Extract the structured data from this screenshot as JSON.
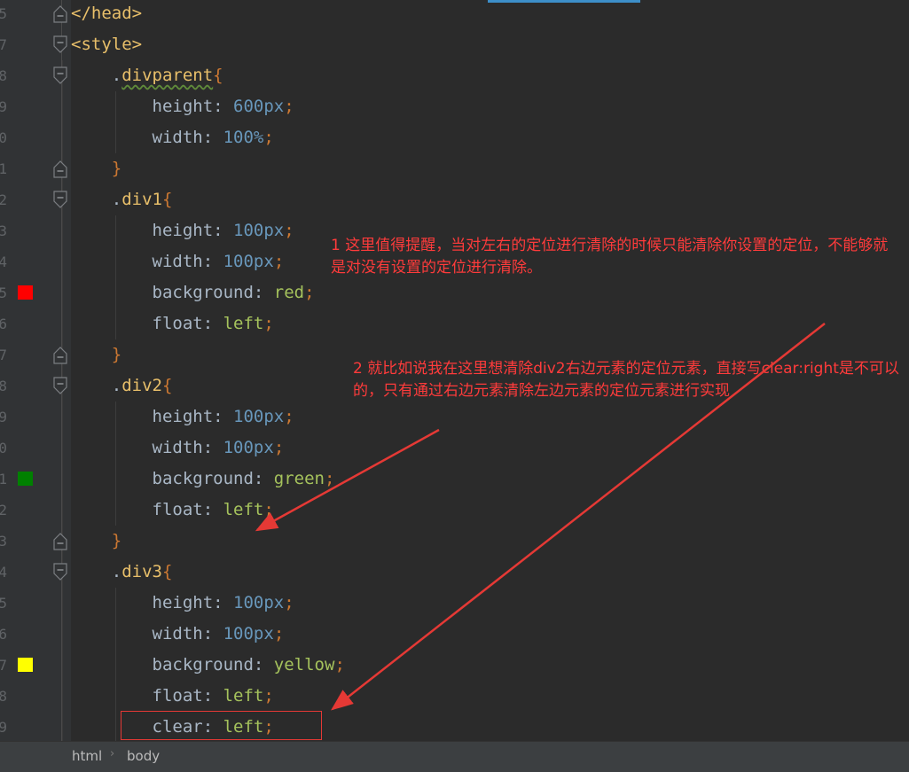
{
  "lines": [
    {
      "n": "5",
      "fold": "end",
      "code": [
        {
          "t": "tag",
          "s": "</head>"
        }
      ]
    },
    {
      "n": "7",
      "fold": "start",
      "code": [
        {
          "t": "tag",
          "s": "<style>"
        }
      ]
    },
    {
      "n": "8",
      "fold": "start",
      "code": [
        {
          "t": "plain",
          "s": "    ."
        },
        {
          "t": "sel-sq",
          "s": "divparent"
        },
        {
          "t": "punct",
          "s": "{"
        }
      ]
    },
    {
      "n": "9",
      "code": [
        {
          "t": "plain",
          "s": "        "
        },
        {
          "t": "prop",
          "s": "height"
        },
        {
          "t": "plain",
          "s": ": "
        },
        {
          "t": "num",
          "s": "600px"
        },
        {
          "t": "punct",
          "s": ";"
        }
      ]
    },
    {
      "n": "0",
      "code": [
        {
          "t": "plain",
          "s": "        "
        },
        {
          "t": "prop",
          "s": "width"
        },
        {
          "t": "plain",
          "s": ": "
        },
        {
          "t": "num",
          "s": "100%"
        },
        {
          "t": "punct",
          "s": ";"
        }
      ]
    },
    {
      "n": "1",
      "fold": "end",
      "code": [
        {
          "t": "plain",
          "s": "    "
        },
        {
          "t": "punct",
          "s": "}"
        }
      ]
    },
    {
      "n": "2",
      "fold": "start",
      "code": [
        {
          "t": "plain",
          "s": "    ."
        },
        {
          "t": "sel",
          "s": "div1"
        },
        {
          "t": "punct",
          "s": "{"
        }
      ]
    },
    {
      "n": "3",
      "code": [
        {
          "t": "plain",
          "s": "        "
        },
        {
          "t": "prop",
          "s": "height"
        },
        {
          "t": "plain",
          "s": ": "
        },
        {
          "t": "num",
          "s": "100px"
        },
        {
          "t": "punct",
          "s": ";"
        }
      ]
    },
    {
      "n": "4",
      "code": [
        {
          "t": "plain",
          "s": "        "
        },
        {
          "t": "prop",
          "s": "width"
        },
        {
          "t": "plain",
          "s": ": "
        },
        {
          "t": "num",
          "s": "100px"
        },
        {
          "t": "punct",
          "s": ";"
        }
      ]
    },
    {
      "n": "5",
      "swatch": "#ff0000",
      "code": [
        {
          "t": "plain",
          "s": "        "
        },
        {
          "t": "prop",
          "s": "background"
        },
        {
          "t": "plain",
          "s": ": "
        },
        {
          "t": "val",
          "s": "red"
        },
        {
          "t": "punct",
          "s": ";"
        }
      ]
    },
    {
      "n": "6",
      "code": [
        {
          "t": "plain",
          "s": "        "
        },
        {
          "t": "prop",
          "s": "float"
        },
        {
          "t": "plain",
          "s": ": "
        },
        {
          "t": "val",
          "s": "left"
        },
        {
          "t": "punct",
          "s": ";"
        }
      ]
    },
    {
      "n": "7",
      "fold": "end",
      "code": [
        {
          "t": "plain",
          "s": "    "
        },
        {
          "t": "punct",
          "s": "}"
        }
      ]
    },
    {
      "n": "8",
      "fold": "start",
      "code": [
        {
          "t": "plain",
          "s": "    ."
        },
        {
          "t": "sel",
          "s": "div2"
        },
        {
          "t": "punct",
          "s": "{"
        }
      ]
    },
    {
      "n": "9",
      "code": [
        {
          "t": "plain",
          "s": "        "
        },
        {
          "t": "prop",
          "s": "height"
        },
        {
          "t": "plain",
          "s": ": "
        },
        {
          "t": "num",
          "s": "100px"
        },
        {
          "t": "punct",
          "s": ";"
        }
      ]
    },
    {
      "n": "0",
      "code": [
        {
          "t": "plain",
          "s": "        "
        },
        {
          "t": "prop",
          "s": "width"
        },
        {
          "t": "plain",
          "s": ": "
        },
        {
          "t": "num",
          "s": "100px"
        },
        {
          "t": "punct",
          "s": ";"
        }
      ]
    },
    {
      "n": "1",
      "swatch": "#008000",
      "code": [
        {
          "t": "plain",
          "s": "        "
        },
        {
          "t": "prop",
          "s": "background"
        },
        {
          "t": "plain",
          "s": ": "
        },
        {
          "t": "val",
          "s": "green"
        },
        {
          "t": "punct",
          "s": ";"
        }
      ]
    },
    {
      "n": "2",
      "code": [
        {
          "t": "plain",
          "s": "        "
        },
        {
          "t": "prop",
          "s": "float"
        },
        {
          "t": "plain",
          "s": ": "
        },
        {
          "t": "val",
          "s": "left"
        },
        {
          "t": "punct",
          "s": ";"
        }
      ]
    },
    {
      "n": "3",
      "fold": "end",
      "code": [
        {
          "t": "plain",
          "s": "    "
        },
        {
          "t": "punct",
          "s": "}"
        }
      ]
    },
    {
      "n": "4",
      "fold": "start",
      "code": [
        {
          "t": "plain",
          "s": "    ."
        },
        {
          "t": "sel",
          "s": "div3"
        },
        {
          "t": "punct",
          "s": "{"
        }
      ]
    },
    {
      "n": "5",
      "code": [
        {
          "t": "plain",
          "s": "        "
        },
        {
          "t": "prop",
          "s": "height"
        },
        {
          "t": "plain",
          "s": ": "
        },
        {
          "t": "num",
          "s": "100px"
        },
        {
          "t": "punct",
          "s": ";"
        }
      ]
    },
    {
      "n": "6",
      "code": [
        {
          "t": "plain",
          "s": "        "
        },
        {
          "t": "prop",
          "s": "width"
        },
        {
          "t": "plain",
          "s": ": "
        },
        {
          "t": "num",
          "s": "100px"
        },
        {
          "t": "punct",
          "s": ";"
        }
      ]
    },
    {
      "n": "7",
      "swatch": "#ffff00",
      "code": [
        {
          "t": "plain",
          "s": "        "
        },
        {
          "t": "prop",
          "s": "background"
        },
        {
          "t": "plain",
          "s": ": "
        },
        {
          "t": "val",
          "s": "yellow"
        },
        {
          "t": "punct",
          "s": ";"
        }
      ]
    },
    {
      "n": "8",
      "code": [
        {
          "t": "plain",
          "s": "        "
        },
        {
          "t": "prop",
          "s": "float"
        },
        {
          "t": "plain",
          "s": ": "
        },
        {
          "t": "val",
          "s": "left"
        },
        {
          "t": "punct",
          "s": ";"
        }
      ]
    },
    {
      "n": "9",
      "code": [
        {
          "t": "plain",
          "s": "        "
        },
        {
          "t": "prop",
          "s": "clear"
        },
        {
          "t": "plain",
          "s": ": "
        },
        {
          "t": "val",
          "s": "left"
        },
        {
          "t": "punct",
          "s": ";"
        }
      ]
    }
  ],
  "annotations": {
    "note1": "1 这里值得提醒，当对左右的定位进行清除的时候只能清除你设置的定位，不能够就是对没有设置的定位进行清除。",
    "note2": "2 就比如说我在这里想清除div2右边元素的定位元素，直接写clear:right是不可以的，只有通过右边元素清除左边元素的定位元素进行实现"
  },
  "statusbar": {
    "breadcrumb": [
      "html",
      "body"
    ],
    "separator": "›"
  },
  "colors": {
    "annotation": "#ff3b3b",
    "background": "#2b2b2b",
    "gutter": "#313335"
  }
}
